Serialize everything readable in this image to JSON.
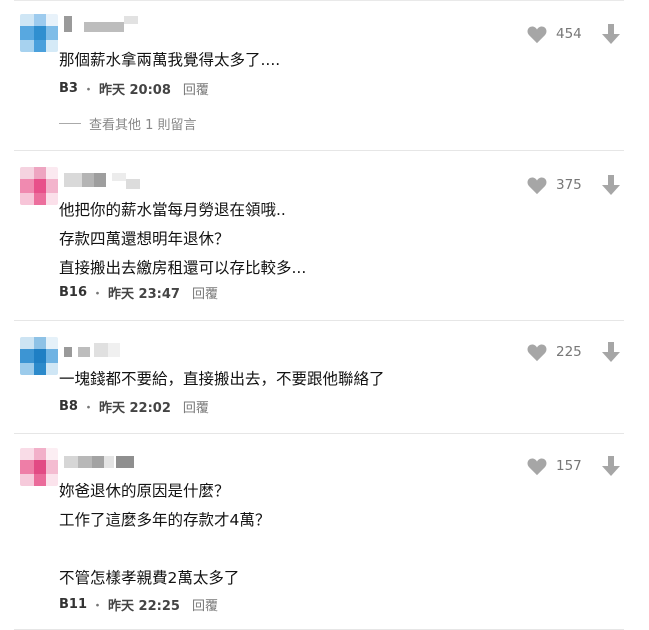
{
  "comments": [
    {
      "text": "那個薪水拿兩萬我覺得太多了....",
      "floor": "B3",
      "time": "昨天 20:08",
      "reply": "回覆",
      "likes": "454",
      "more_replies": "查看其他 1 則留言",
      "avatar_icon": "avatar-blue-mosaic",
      "like_icon": "heart-icon",
      "dislike_icon": "down-arrow-icon"
    },
    {
      "text": "他把你的薪水當每月勞退在領哦..\n存款四萬還想明年退休？\n直接搬出去繳房租還可以存比較多...",
      "floor": "B16",
      "time": "昨天 23:47",
      "reply": "回覆",
      "likes": "375",
      "avatar_icon": "avatar-pink-mosaic"
    },
    {
      "text": "一塊錢都不要給，直接搬出去，不要跟他聯絡了",
      "floor": "B8",
      "time": "昨天 22:02",
      "reply": "回覆",
      "likes": "225",
      "avatar_icon": "avatar-blue-mosaic"
    },
    {
      "text": "妳爸退休的原因是什麼？\n工作了這麼多年的存款才4萬？\n\n不管怎樣孝親費2萬太多了",
      "floor": "B11",
      "time": "昨天 22:25",
      "reply": "回覆",
      "likes": "157",
      "avatar_icon": "avatar-pink-mosaic"
    }
  ],
  "colors": {
    "icon_gray": "#a6a6a6",
    "separator": "#e6e6e6",
    "blue_avatar": "#2f8fd0",
    "pink_avatar": "#e8508a"
  }
}
